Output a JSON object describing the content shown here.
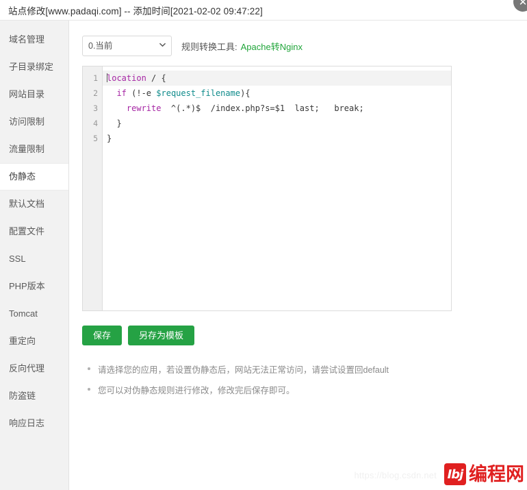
{
  "window": {
    "title": "站点修改[www.padaqi.com] -- 添加时间[2021-02-02 09:47:22]",
    "close_label": "✕"
  },
  "sidebar": {
    "items": [
      {
        "label": "域名管理",
        "active": false
      },
      {
        "label": "子目录绑定",
        "active": false
      },
      {
        "label": "网站目录",
        "active": false
      },
      {
        "label": "访问限制",
        "active": false
      },
      {
        "label": "流量限制",
        "active": false
      },
      {
        "label": "伪静态",
        "active": true
      },
      {
        "label": "默认文档",
        "active": false
      },
      {
        "label": "配置文件",
        "active": false
      },
      {
        "label": "SSL",
        "active": false
      },
      {
        "label": "PHP版本",
        "active": false
      },
      {
        "label": "Tomcat",
        "active": false
      },
      {
        "label": "重定向",
        "active": false
      },
      {
        "label": "反向代理",
        "active": false
      },
      {
        "label": "防盗链",
        "active": false
      },
      {
        "label": "响应日志",
        "active": false
      }
    ]
  },
  "toolbar": {
    "select_value": "0.当前",
    "select_options": [
      "0.当前"
    ],
    "converter_label": "规则转换工具:",
    "converter_link": "Apache转Nginx"
  },
  "editor": {
    "line_numbers": [
      "1",
      "2",
      "3",
      "4",
      "5"
    ],
    "lines": [
      {
        "num": "1",
        "text": "location / {"
      },
      {
        "num": "2",
        "text": "  if (!-e $request_filename){"
      },
      {
        "num": "3",
        "text": "    rewrite  ^(.*)$  /index.php?s=$1  last;   break;"
      },
      {
        "num": "4",
        "text": "  }"
      },
      {
        "num": "5",
        "text": "}"
      }
    ],
    "tokens": {
      "l1_kw": "location",
      "l1_rest": " / {",
      "l2_indent": "  ",
      "l2_kw": "if",
      "l2_mid": " (!-e ",
      "l2_var": "$request_filename",
      "l2_rest": "){",
      "l3_indent": "    ",
      "l3_kw": "rewrite",
      "l3_rest": "  ^(.*)$  /index.php?s=$1  last;   break;",
      "l4_text": "  }",
      "l5_text": "}"
    }
  },
  "buttons": {
    "save": "保存",
    "save_as_template": "另存为模板"
  },
  "notes": [
    "请选择您的应用，若设置伪静态后，网站无法正常访问，请尝试设置回default",
    "您可以对伪静态规则进行修改，修改完后保存即可。"
  ],
  "watermark": {
    "text": "https://blog.csdn.net"
  },
  "brand": {
    "mark": "Ibj",
    "text": "编程网"
  },
  "colors": {
    "accent_green": "#25a244",
    "link_green": "#20a53a",
    "brand_red": "#e02020",
    "sidebar_bg": "#f2f2f2",
    "keyword_purple": "#a626a4",
    "variable_teal": "#0f8b8b"
  }
}
